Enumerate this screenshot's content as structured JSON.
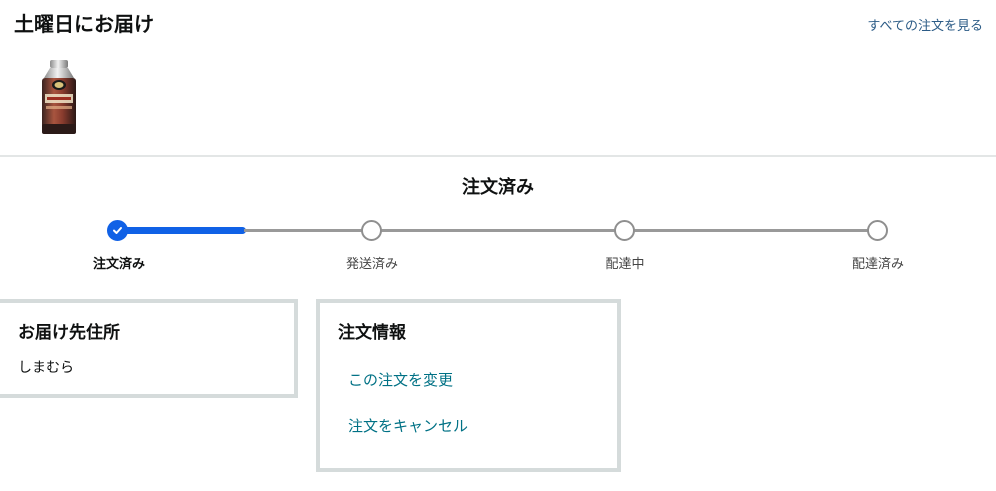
{
  "header": {
    "delivery_title": "土曜日にお届け",
    "all_orders_link": "すべての注文を見る"
  },
  "product": {
    "image_icon": "coffee-can-bottle"
  },
  "status": {
    "title": "注文済み",
    "accent_color": "#1061e6",
    "steps": [
      {
        "label": "注文済み",
        "state": "done"
      },
      {
        "label": "発送済み",
        "state": "pending"
      },
      {
        "label": "配達中",
        "state": "pending"
      },
      {
        "label": "配達済み",
        "state": "pending"
      }
    ]
  },
  "address_card": {
    "title": "お届け先住所",
    "name": "しまむら"
  },
  "order_card": {
    "title": "注文情報",
    "change_link": "この注文を変更",
    "cancel_link": "注文をキャンセル"
  }
}
